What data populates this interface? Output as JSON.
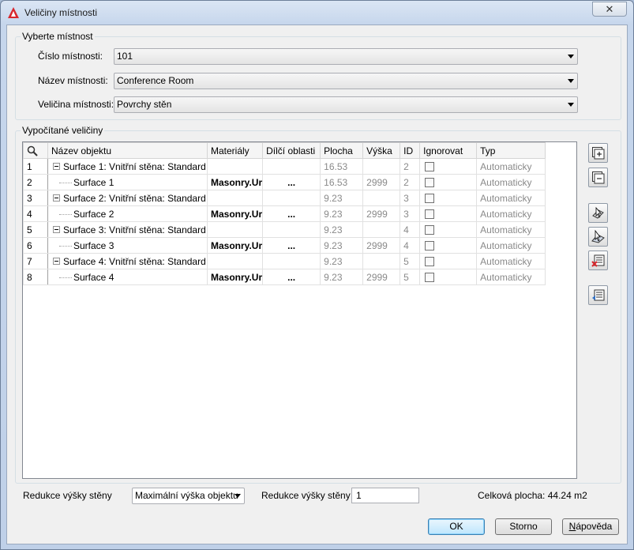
{
  "window": {
    "title": "Veličiny místnosti",
    "close_symbol": "✕"
  },
  "select_room": {
    "legend": "Vyberte místnost",
    "fields": [
      {
        "label": "Číslo místnosti:",
        "value": "101"
      },
      {
        "label": "Název místnosti:",
        "value": "Conference Room"
      },
      {
        "label": "Veličina místnosti:",
        "value": "Povrchy stěn"
      }
    ]
  },
  "computed": {
    "legend": "Vypočítané veličiny",
    "columns": [
      "Název objektu",
      "Materiály",
      "Dílčí oblasti",
      "Plocha",
      "Výška",
      "ID",
      "Ignorovat",
      "Typ"
    ],
    "rows": [
      {
        "num": "1",
        "level": 0,
        "name": "Surface 1: Vnitřní stěna: Standard",
        "material": "",
        "subareas": "",
        "area": "16.53",
        "height": "",
        "id": "2",
        "ignore": false,
        "type": "Automaticky"
      },
      {
        "num": "2",
        "level": 1,
        "name": "Surface 1",
        "material": "Masonry.Ur",
        "subareas": "...",
        "area": "16.53",
        "height": "2999",
        "id": "2",
        "ignore": false,
        "type": "Automaticky"
      },
      {
        "num": "3",
        "level": 0,
        "name": "Surface 2: Vnitřní stěna: Standard",
        "material": "",
        "subareas": "",
        "area": "9.23",
        "height": "",
        "id": "3",
        "ignore": false,
        "type": "Automaticky"
      },
      {
        "num": "4",
        "level": 1,
        "name": "Surface 2",
        "material": "Masonry.Ur",
        "subareas": "...",
        "area": "9.23",
        "height": "2999",
        "id": "3",
        "ignore": false,
        "type": "Automaticky"
      },
      {
        "num": "5",
        "level": 0,
        "name": "Surface 3: Vnitřní stěna: Standard",
        "material": "",
        "subareas": "",
        "area": "9.23",
        "height": "",
        "id": "4",
        "ignore": false,
        "type": "Automaticky"
      },
      {
        "num": "6",
        "level": 1,
        "name": "Surface 3",
        "material": "Masonry.Ur",
        "subareas": "...",
        "area": "9.23",
        "height": "2999",
        "id": "4",
        "ignore": false,
        "type": "Automaticky"
      },
      {
        "num": "7",
        "level": 0,
        "name": "Surface 4: Vnitřní stěna: Standard",
        "material": "",
        "subareas": "",
        "area": "9.23",
        "height": "",
        "id": "5",
        "ignore": false,
        "type": "Automaticky"
      },
      {
        "num": "8",
        "level": 1,
        "name": "Surface 4",
        "material": "Masonry.Ur",
        "subareas": "...",
        "area": "9.23",
        "height": "2999",
        "id": "5",
        "ignore": false,
        "type": "Automaticky"
      }
    ],
    "side_buttons": [
      "expand-all-icon",
      "collapse-all-icon",
      "select-wall-icon",
      "pick-surface-icon",
      "delete-rows-icon",
      "import-rows-icon"
    ]
  },
  "bottom": {
    "reduction_label_1": "Redukce výšky stěny",
    "reduction_select": "Maximální výška objektu",
    "reduction_label_2": "Redukce výšky stěny",
    "reduction_value": "1",
    "total_area": "Celková plocha: 44.24 m2"
  },
  "buttons": {
    "ok": "OK",
    "cancel": "Storno",
    "help": "Nápověda"
  },
  "colors": {
    "title_gradient_top": "#dbe6f4",
    "default_button": "#bee6fd",
    "muted_text": "#8a8a8a"
  }
}
